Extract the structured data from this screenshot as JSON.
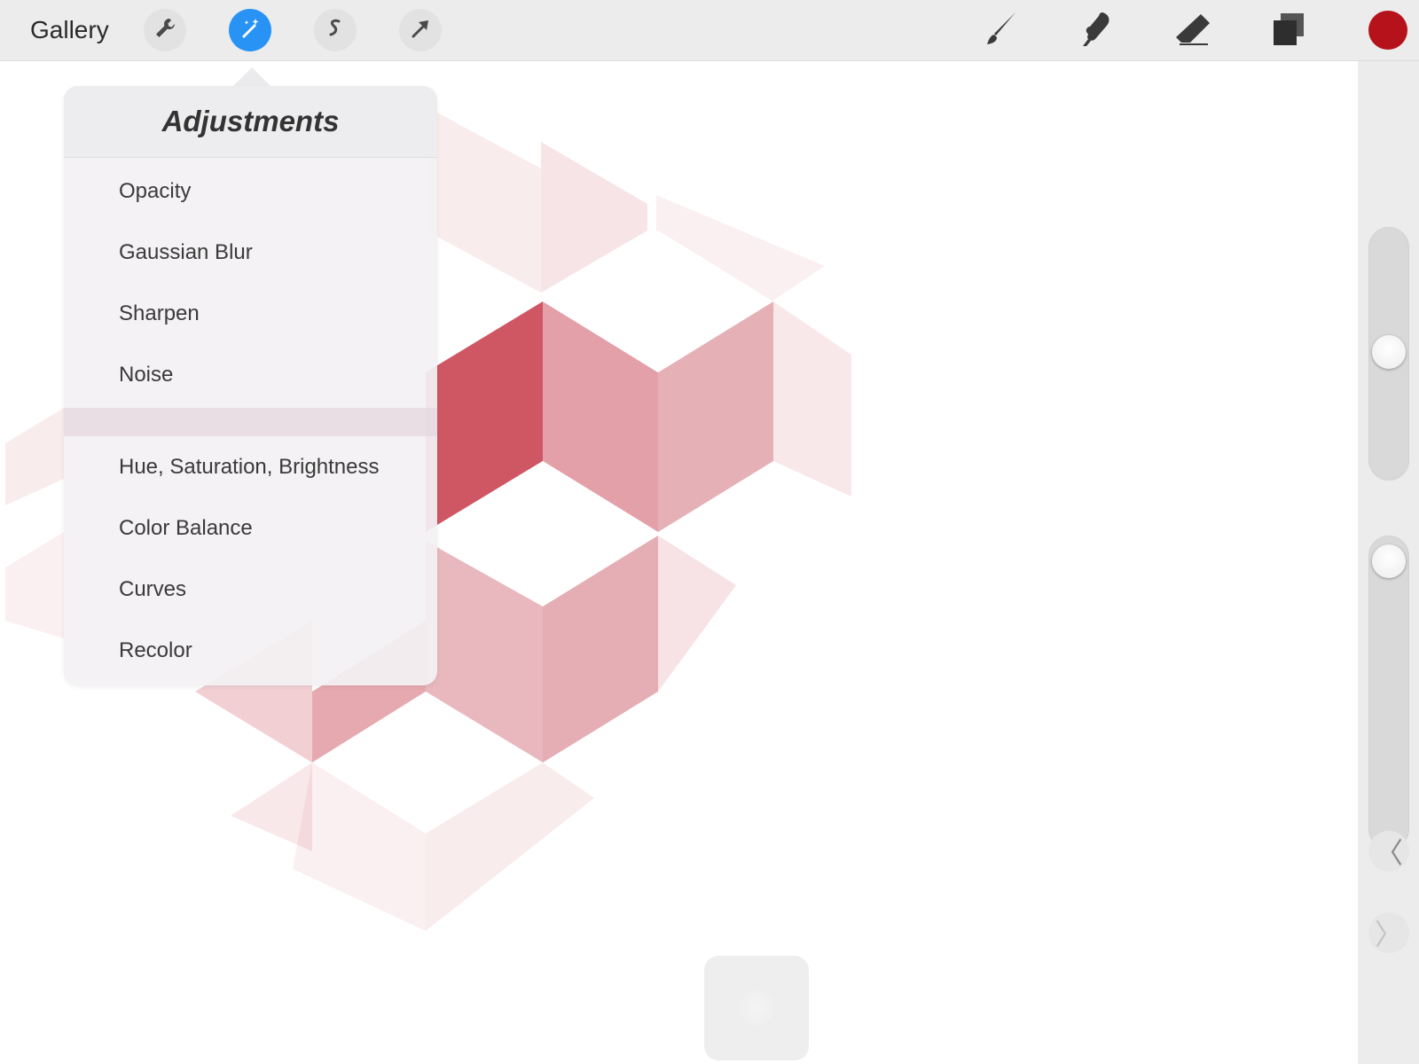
{
  "toolbar": {
    "gallery_label": "Gallery",
    "left_tools": [
      {
        "name": "wrench-icon",
        "active": false
      },
      {
        "name": "magic-wand-icon",
        "active": true
      },
      {
        "name": "selection-s-icon",
        "active": false
      },
      {
        "name": "arrow-icon",
        "active": false
      }
    ],
    "right_tools": [
      "brush-icon",
      "smudge-icon",
      "eraser-icon",
      "layers-icon"
    ],
    "current_color": "#b6121c"
  },
  "adjustments": {
    "title": "Adjustments",
    "group1": [
      "Opacity",
      "Gaussian Blur",
      "Sharpen",
      "Noise"
    ],
    "group2": [
      "Hue, Saturation, Brightness",
      "Color Balance",
      "Curves",
      "Recolor"
    ]
  },
  "sidebar": {
    "brush_size_level": 0.52,
    "opacity_level": 0.94,
    "undo_icon": "chevron-left-icon",
    "redo_icon": "chevron-right-icon"
  },
  "colors": {
    "accent": "#2893f4",
    "art_red": "#c8404f"
  }
}
